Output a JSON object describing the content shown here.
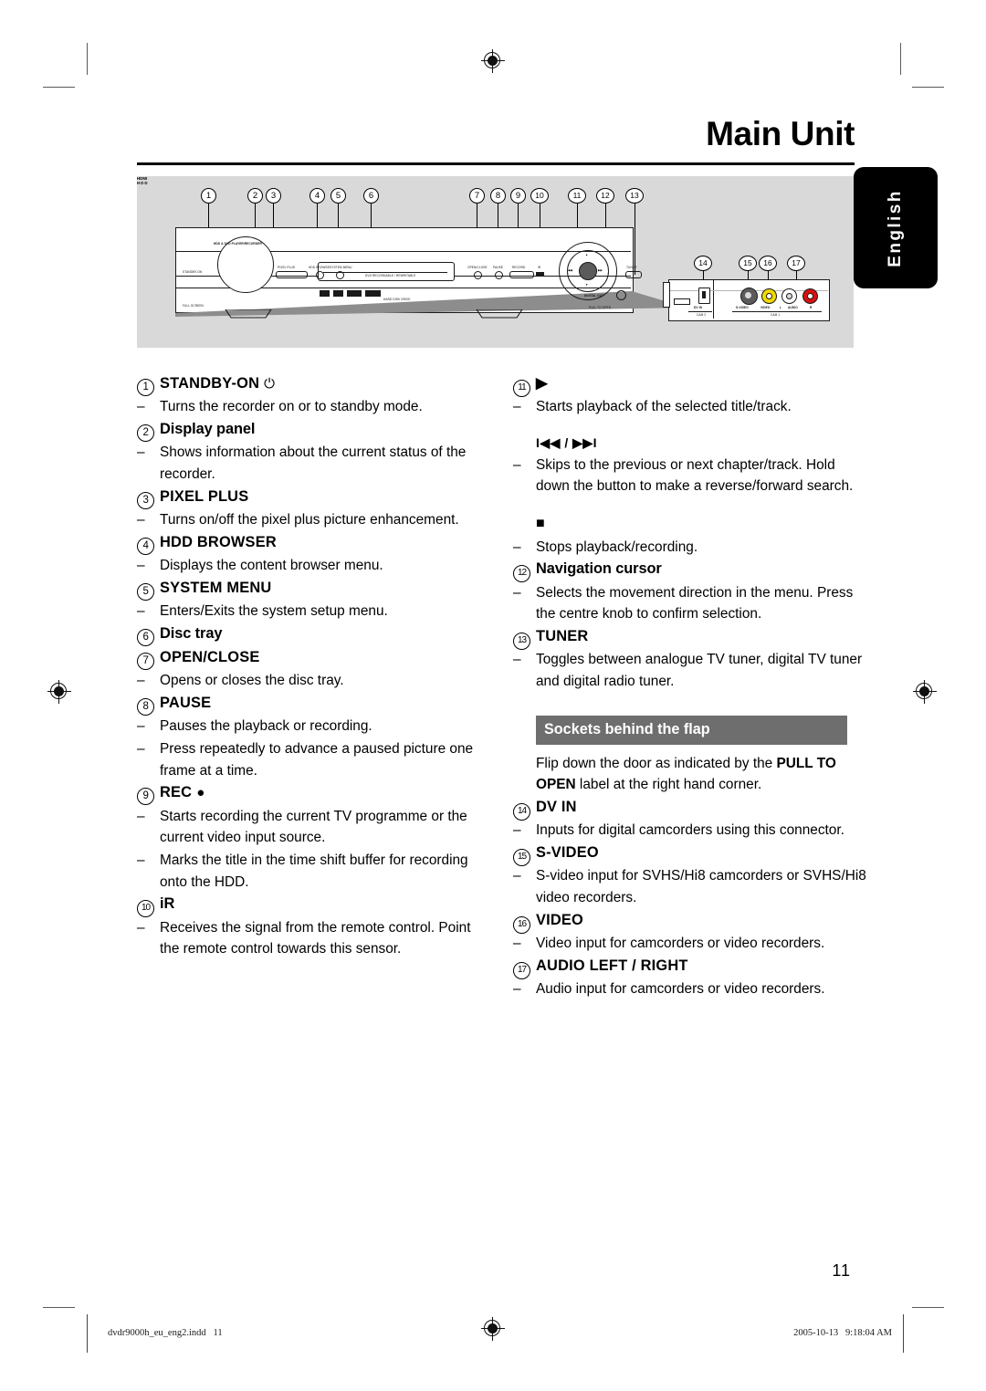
{
  "page": {
    "title": "Main Unit",
    "language_tab": "English",
    "number": "11"
  },
  "figure": {
    "callouts": [
      "1",
      "2",
      "3",
      "4",
      "5",
      "6",
      "7",
      "8",
      "9",
      "10",
      "11",
      "12",
      "13",
      "14",
      "15",
      "16",
      "17"
    ],
    "unit_labels": {
      "brand_line": "HDD & DVD PLAYER/RECORDER",
      "standby": "STANDBY-ON",
      "pixel_plus": "PIXEL PLUS",
      "hdd_browse": "HDD BROWSE",
      "system_menu": "SYSTEM MENU",
      "tray": "DVD RECORDABLE / REWRITABLE",
      "open_close": "OPEN/CLOSE",
      "pause": "PAUSE",
      "record": "RECORD",
      "ir": "iR",
      "tuner": "TUNER",
      "hdmi": "HDMI",
      "hdd_logo": "HDD",
      "hdd_sub": "HARD DISK DRIVE",
      "full_screen": "FULL SCREEN",
      "pull_to_open": "PULL TO OPEN",
      "digital_out": "DIGITAL OUT",
      "nav_up": "▲",
      "nav_down": "▼",
      "nav_prev": "◀◀",
      "nav_next": "▶▶"
    },
    "socket_labels": {
      "dv_in": "DV IN",
      "cam2": "CAM 2",
      "s_video": "S-VIDEO",
      "video": "VIDEO",
      "audio_l": "L",
      "audio": "AUDIO",
      "audio_r": "R",
      "cam1": "CAM 1"
    },
    "socket_colors": {
      "s_video": "#5b5b5b",
      "video": "#f2d900",
      "audio_left": "#ffffff",
      "audio_right": "#d81111"
    }
  },
  "left_column": [
    {
      "num": "1",
      "title": "STANDBY-ON",
      "glyph": "⏻",
      "bullets": [
        "Turns the recorder on or to standby mode."
      ]
    },
    {
      "num": "2",
      "title": "Display panel",
      "glyph": "",
      "bullets": [
        "Shows information about the current status of the recorder."
      ]
    },
    {
      "num": "3",
      "title": "PIXEL PLUS",
      "glyph": "",
      "bullets": [
        "Turns on/off the pixel plus picture enhancement."
      ]
    },
    {
      "num": "4",
      "title": "HDD BROWSER",
      "glyph": "",
      "bullets": [
        "Displays the content browser menu."
      ]
    },
    {
      "num": "5",
      "title": "SYSTEM MENU",
      "glyph": "",
      "bullets": [
        "Enters/Exits the system setup menu."
      ]
    },
    {
      "num": "6",
      "title": "Disc tray",
      "glyph": "",
      "bullets": []
    },
    {
      "num": "7",
      "title": "OPEN/CLOSE",
      "glyph": "",
      "bullets": [
        "Opens or closes the disc tray."
      ]
    },
    {
      "num": "8",
      "title": "PAUSE",
      "glyph": "",
      "bullets": [
        "Pauses the playback or recording.",
        "Press repeatedly to advance a paused picture one frame at a time."
      ]
    },
    {
      "num": "9",
      "title": "REC",
      "glyph": "●",
      "bullets": [
        "Starts recording the current TV programme or the current video input source.",
        "Marks the title in the time shift buffer for recording onto the HDD."
      ]
    },
    {
      "num": "10",
      "title": "iR",
      "glyph": "",
      "bullets": [
        "Receives the signal from the remote control.  Point the remote control towards this sensor."
      ]
    }
  ],
  "right_column": {
    "entry_11": {
      "num": "11",
      "title": "",
      "glyph": "▶",
      "bullets": [
        "Starts playback of the selected title/track."
      ],
      "sub_skip": {
        "glyph": "I◀◀ / ▶▶I",
        "bullets": [
          "Skips to the previous or next chapter/track. Hold down the button to make a reverse/forward search."
        ]
      },
      "sub_stop": {
        "glyph": "■",
        "bullets": [
          "Stops playback/recording."
        ]
      }
    },
    "entries": [
      {
        "num": "12",
        "title": "Navigation cursor",
        "glyph": "",
        "bullets": [
          "Selects the movement direction in the menu.  Press the centre knob to confirm selection."
        ]
      },
      {
        "num": "13",
        "title": "TUNER",
        "glyph": "",
        "bullets": [
          "Toggles between analogue TV tuner, digital TV tuner and digital radio tuner."
        ]
      }
    ],
    "section": {
      "heading": "Sockets behind the flap",
      "intro_before": "Flip down the door as indicated by the ",
      "intro_bold": "PULL TO OPEN",
      "intro_after": " label at the right hand corner."
    },
    "socket_entries": [
      {
        "num": "14",
        "title": "DV IN",
        "glyph": "",
        "bullets": [
          "Inputs for digital camcorders using this connector."
        ]
      },
      {
        "num": "15",
        "title": "S-VIDEO",
        "glyph": "",
        "bullets": [
          "S-video input for SVHS/Hi8 camcorders or SVHS/Hi8 video recorders."
        ]
      },
      {
        "num": "16",
        "title": "VIDEO",
        "glyph": "",
        "bullets": [
          "Video input for camcorders or video recorders."
        ]
      },
      {
        "num": "17",
        "title": "AUDIO LEFT / RIGHT",
        "glyph": "",
        "bullets": [
          "Audio input for camcorders or video recorders."
        ]
      }
    ]
  },
  "footer": {
    "file": "dvdr9000h_eu_eng2.indd   11",
    "date": "2005-10-13   9:18:04 AM"
  }
}
